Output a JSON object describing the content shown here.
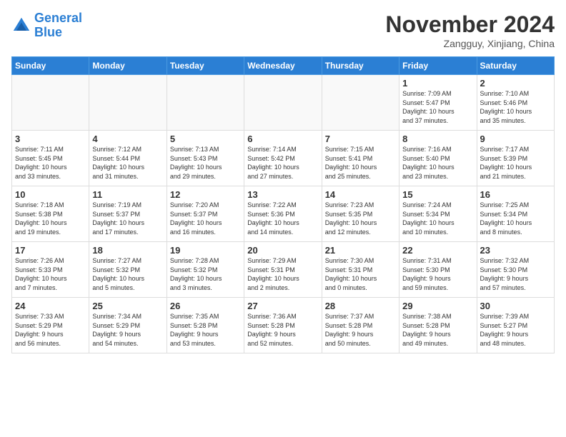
{
  "header": {
    "logo_line1": "General",
    "logo_line2": "Blue",
    "month_title": "November 2024",
    "location": "Zangguy, Xinjiang, China"
  },
  "weekdays": [
    "Sunday",
    "Monday",
    "Tuesday",
    "Wednesday",
    "Thursday",
    "Friday",
    "Saturday"
  ],
  "weeks": [
    [
      {
        "day": "",
        "info": ""
      },
      {
        "day": "",
        "info": ""
      },
      {
        "day": "",
        "info": ""
      },
      {
        "day": "",
        "info": ""
      },
      {
        "day": "",
        "info": ""
      },
      {
        "day": "1",
        "info": "Sunrise: 7:09 AM\nSunset: 5:47 PM\nDaylight: 10 hours\nand 37 minutes."
      },
      {
        "day": "2",
        "info": "Sunrise: 7:10 AM\nSunset: 5:46 PM\nDaylight: 10 hours\nand 35 minutes."
      }
    ],
    [
      {
        "day": "3",
        "info": "Sunrise: 7:11 AM\nSunset: 5:45 PM\nDaylight: 10 hours\nand 33 minutes."
      },
      {
        "day": "4",
        "info": "Sunrise: 7:12 AM\nSunset: 5:44 PM\nDaylight: 10 hours\nand 31 minutes."
      },
      {
        "day": "5",
        "info": "Sunrise: 7:13 AM\nSunset: 5:43 PM\nDaylight: 10 hours\nand 29 minutes."
      },
      {
        "day": "6",
        "info": "Sunrise: 7:14 AM\nSunset: 5:42 PM\nDaylight: 10 hours\nand 27 minutes."
      },
      {
        "day": "7",
        "info": "Sunrise: 7:15 AM\nSunset: 5:41 PM\nDaylight: 10 hours\nand 25 minutes."
      },
      {
        "day": "8",
        "info": "Sunrise: 7:16 AM\nSunset: 5:40 PM\nDaylight: 10 hours\nand 23 minutes."
      },
      {
        "day": "9",
        "info": "Sunrise: 7:17 AM\nSunset: 5:39 PM\nDaylight: 10 hours\nand 21 minutes."
      }
    ],
    [
      {
        "day": "10",
        "info": "Sunrise: 7:18 AM\nSunset: 5:38 PM\nDaylight: 10 hours\nand 19 minutes."
      },
      {
        "day": "11",
        "info": "Sunrise: 7:19 AM\nSunset: 5:37 PM\nDaylight: 10 hours\nand 17 minutes."
      },
      {
        "day": "12",
        "info": "Sunrise: 7:20 AM\nSunset: 5:37 PM\nDaylight: 10 hours\nand 16 minutes."
      },
      {
        "day": "13",
        "info": "Sunrise: 7:22 AM\nSunset: 5:36 PM\nDaylight: 10 hours\nand 14 minutes."
      },
      {
        "day": "14",
        "info": "Sunrise: 7:23 AM\nSunset: 5:35 PM\nDaylight: 10 hours\nand 12 minutes."
      },
      {
        "day": "15",
        "info": "Sunrise: 7:24 AM\nSunset: 5:34 PM\nDaylight: 10 hours\nand 10 minutes."
      },
      {
        "day": "16",
        "info": "Sunrise: 7:25 AM\nSunset: 5:34 PM\nDaylight: 10 hours\nand 8 minutes."
      }
    ],
    [
      {
        "day": "17",
        "info": "Sunrise: 7:26 AM\nSunset: 5:33 PM\nDaylight: 10 hours\nand 7 minutes."
      },
      {
        "day": "18",
        "info": "Sunrise: 7:27 AM\nSunset: 5:32 PM\nDaylight: 10 hours\nand 5 minutes."
      },
      {
        "day": "19",
        "info": "Sunrise: 7:28 AM\nSunset: 5:32 PM\nDaylight: 10 hours\nand 3 minutes."
      },
      {
        "day": "20",
        "info": "Sunrise: 7:29 AM\nSunset: 5:31 PM\nDaylight: 10 hours\nand 2 minutes."
      },
      {
        "day": "21",
        "info": "Sunrise: 7:30 AM\nSunset: 5:31 PM\nDaylight: 10 hours\nand 0 minutes."
      },
      {
        "day": "22",
        "info": "Sunrise: 7:31 AM\nSunset: 5:30 PM\nDaylight: 9 hours\nand 59 minutes."
      },
      {
        "day": "23",
        "info": "Sunrise: 7:32 AM\nSunset: 5:30 PM\nDaylight: 9 hours\nand 57 minutes."
      }
    ],
    [
      {
        "day": "24",
        "info": "Sunrise: 7:33 AM\nSunset: 5:29 PM\nDaylight: 9 hours\nand 56 minutes."
      },
      {
        "day": "25",
        "info": "Sunrise: 7:34 AM\nSunset: 5:29 PM\nDaylight: 9 hours\nand 54 minutes."
      },
      {
        "day": "26",
        "info": "Sunrise: 7:35 AM\nSunset: 5:28 PM\nDaylight: 9 hours\nand 53 minutes."
      },
      {
        "day": "27",
        "info": "Sunrise: 7:36 AM\nSunset: 5:28 PM\nDaylight: 9 hours\nand 52 minutes."
      },
      {
        "day": "28",
        "info": "Sunrise: 7:37 AM\nSunset: 5:28 PM\nDaylight: 9 hours\nand 50 minutes."
      },
      {
        "day": "29",
        "info": "Sunrise: 7:38 AM\nSunset: 5:28 PM\nDaylight: 9 hours\nand 49 minutes."
      },
      {
        "day": "30",
        "info": "Sunrise: 7:39 AM\nSunset: 5:27 PM\nDaylight: 9 hours\nand 48 minutes."
      }
    ]
  ]
}
